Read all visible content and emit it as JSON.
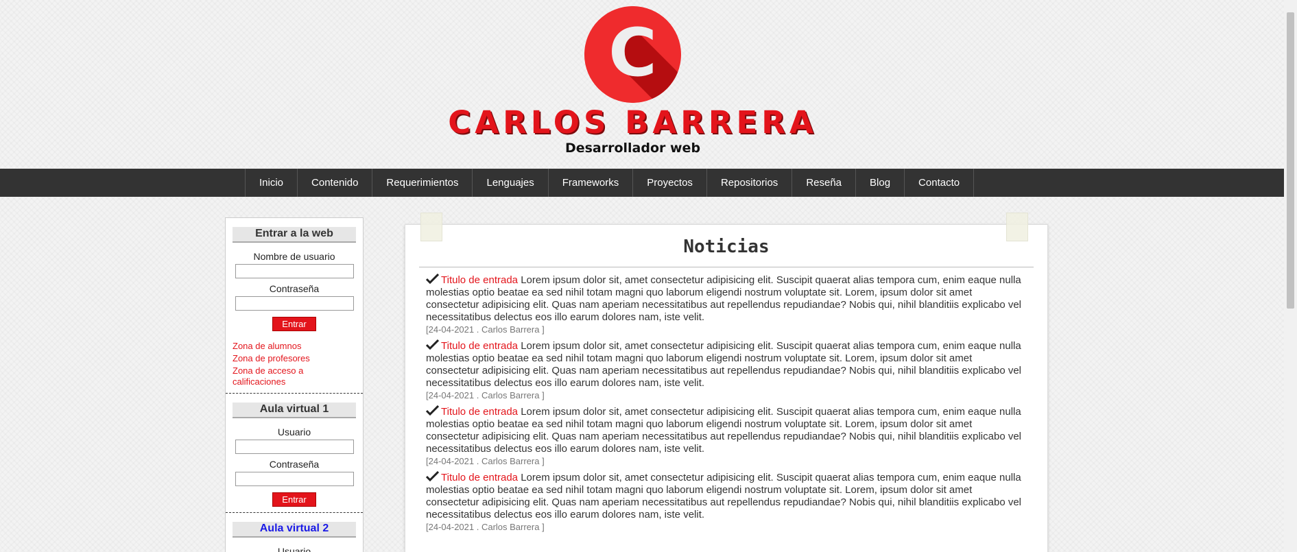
{
  "header": {
    "logo_letter": "C",
    "brand_name": "CARLOS BARRERA",
    "subtitle": "Desarrollador web"
  },
  "nav": {
    "items": [
      {
        "label": "Inicio"
      },
      {
        "label": "Contenido"
      },
      {
        "label": "Requerimientos"
      },
      {
        "label": "Lenguajes"
      },
      {
        "label": "Frameworks"
      },
      {
        "label": "Proyectos"
      },
      {
        "label": "Repositorios"
      },
      {
        "label": "Reseña"
      },
      {
        "label": "Blog"
      },
      {
        "label": "Contacto"
      }
    ]
  },
  "sidebar": {
    "login": {
      "title": "Entrar a la web",
      "username_label": "Nombre de usuario",
      "password_label": "Contraseña",
      "button": "Entrar",
      "links": [
        "Zona de alumnos",
        "Zona de profesores",
        "Zona de acceso a calificaciones"
      ]
    },
    "aula1": {
      "title": "Aula virtual 1",
      "username_label": "Usuario",
      "password_label": "Contraseña",
      "button": "Entrar"
    },
    "aula2": {
      "title": "Aula virtual 2",
      "username_label": "Usuario"
    }
  },
  "main": {
    "title": "Noticias",
    "news": [
      {
        "title": "Titulo de entrada",
        "body": " Lorem ipsum dolor sit, amet consectetur adipisicing elit. Suscipit quaerat alias tempora cum, enim eaque nulla molestias optio beatae ea sed nihil totam magni quo laborum eligendi nostrum voluptate sit. Lorem, ipsum dolor sit amet consectetur adipisicing elit. Quas nam aperiam necessitatibus aut repellendus repudiandae? Nobis qui, nihil blanditiis explicabo vel necessitatibus delectus eos illo earum dolores nam, iste velit.",
        "meta": "[24-04-2021 . Carlos Barrera ]"
      },
      {
        "title": "Titulo de entrada",
        "body": " Lorem ipsum dolor sit, amet consectetur adipisicing elit. Suscipit quaerat alias tempora cum, enim eaque nulla molestias optio beatae ea sed nihil totam magni quo laborum eligendi nostrum voluptate sit. Lorem, ipsum dolor sit amet consectetur adipisicing elit. Quas nam aperiam necessitatibus aut repellendus repudiandae? Nobis qui, nihil blanditiis explicabo vel necessitatibus delectus eos illo earum dolores nam, iste velit.",
        "meta": "[24-04-2021 . Carlos Barrera ]"
      },
      {
        "title": "Titulo de entrada",
        "body": " Lorem ipsum dolor sit, amet consectetur adipisicing elit. Suscipit quaerat alias tempora cum, enim eaque nulla molestias optio beatae ea sed nihil totam magni quo laborum eligendi nostrum voluptate sit. Lorem, ipsum dolor sit amet consectetur adipisicing elit. Quas nam aperiam necessitatibus aut repellendus repudiandae? Nobis qui, nihil blanditiis explicabo vel necessitatibus delectus eos illo earum dolores nam, iste velit.",
        "meta": "[24-04-2021 . Carlos Barrera ]"
      },
      {
        "title": "Titulo de entrada",
        "body": " Lorem ipsum dolor sit, amet consectetur adipisicing elit. Suscipit quaerat alias tempora cum, enim eaque nulla molestias optio beatae ea sed nihil totam magni quo laborum eligendi nostrum voluptate sit. Lorem, ipsum dolor sit amet consectetur adipisicing elit. Quas nam aperiam necessitatibus aut repellendus repudiandae? Nobis qui, nihil blanditiis explicabo vel necessitatibus delectus eos illo earum dolores nam, iste velit.",
        "meta": "[24-04-2021 . Carlos Barrera ]"
      }
    ]
  },
  "colors": {
    "accent": "#e3141b",
    "nav_bg": "#333333",
    "link_blue": "#1a1ae6"
  }
}
